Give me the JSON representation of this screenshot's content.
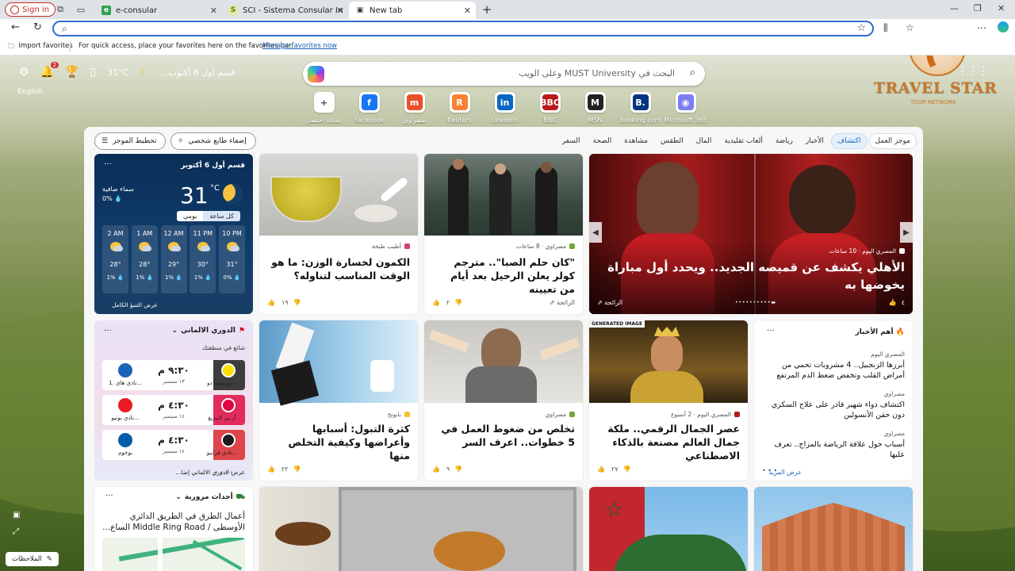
{
  "browser": {
    "signin_label": "Sign in",
    "tabs": [
      {
        "title": "e-consular",
        "icon": "e"
      },
      {
        "title": "SCI - Sistema Consular Integrado",
        "icon": "S"
      },
      {
        "title": "New tab",
        "icon": "▣"
      }
    ],
    "favorites_bar": {
      "import_label": "Import favorites",
      "hint": "For quick access, place your favorites here on the favorites bar.",
      "manage_link": "Manage favorites now"
    }
  },
  "newtab": {
    "topbar": {
      "weather_text": "قسم أول 6 أكتوب...",
      "temperature": "31°C",
      "notification_count": "2",
      "language": "English"
    },
    "search": {
      "placeholder": "البحث في MUST University وعلى الويب"
    },
    "quick_links": [
      {
        "label": "إضافة اختصار",
        "icon": "+",
        "color": "#ffffff",
        "fg": "#444"
      },
      {
        "label": "Facebook",
        "icon": "f",
        "color": "#1877f2",
        "fg": "#fff"
      },
      {
        "label": "مصراوي",
        "icon": "m",
        "color": "#e94e2b",
        "fg": "#fff"
      },
      {
        "label": "Reuters",
        "icon": "R",
        "color": "#fb8033",
        "fg": "#fff"
      },
      {
        "label": "LinkedIn",
        "icon": "in",
        "color": "#0a66c2",
        "fg": "#fff"
      },
      {
        "label": "BBC",
        "icon": "BBC",
        "color": "#bb1919",
        "fg": "#fff"
      },
      {
        "label": "MSN",
        "icon": "M",
        "color": "#222222",
        "fg": "#fff"
      },
      {
        "label": "Booking.com",
        "icon": "B.",
        "color": "#003580",
        "fg": "#fff"
      },
      {
        "label": "Microsoft 365",
        "icon": "◉",
        "color": "#7a7ef0",
        "fg": "#fff"
      }
    ],
    "watermark": {
      "title": "TRAVEL STAR",
      "subtitle": "TOUR NETWORK"
    },
    "notes_label": "الملاحظات"
  },
  "feed": {
    "nav": [
      {
        "label": "موجز العمل"
      },
      {
        "label": "اكتشاف"
      },
      {
        "label": "الأخبار"
      },
      {
        "label": "رياضة"
      },
      {
        "label": "ألعاب تقليدية"
      },
      {
        "label": "المال"
      },
      {
        "label": "الطقس"
      },
      {
        "label": "مشاهدة"
      },
      {
        "label": "الصحة"
      },
      {
        "label": "السفر"
      }
    ],
    "layout_label": "تخطيط الموجز",
    "personalize_label": "إضفاء طابع شخصي",
    "weather": {
      "location_date": "قسم أول 6 أكتوبر",
      "temp": "31",
      "unit": "°C",
      "condition": "سماء صافية",
      "precip": "0% 💧",
      "toggle_hourly": "كل ساعة",
      "toggle_daily": "يومي",
      "hours": [
        {
          "time": "10 PM",
          "temp": "31°",
          "precip": "0% 💧"
        },
        {
          "time": "11 PM",
          "temp": "30°",
          "precip": "1% 💧"
        },
        {
          "time": "12 AM",
          "temp": "29°",
          "precip": "1% 💧"
        },
        {
          "time": "1 AM",
          "temp": "28°",
          "precip": "1% 💧"
        },
        {
          "time": "2 AM",
          "temp": "28°",
          "precip": "1% 💧"
        }
      ],
      "full_forecast": "عرض التنبؤ الكامل"
    },
    "league": {
      "title": "الدوري الالماني",
      "trending": "شائع في منطقتك",
      "matches": [
        {
          "home": "بوروسيا دو...",
          "away": "1. نادي هاي...",
          "time": "٩:٣٠ م",
          "date": "١٣ سبتمبر",
          "home_color": "#fde100",
          "away_color": "#1c63b7",
          "band": "#1b1b1b"
        },
        {
          "home": "آر بي لايبزيغ",
          "away": "نادي يونيو...",
          "time": "٤:٣٠ م",
          "date": "١٤ سبتمبر",
          "home_color": "#dd0741",
          "away_color": "#eb1923",
          "band": "#dd0741"
        },
        {
          "home": "نادي فرايبو...",
          "away": "بوخوم",
          "time": "٤:٣٠ م",
          "date": "١٤ سبتمبر",
          "home_color": "#1b1b1b",
          "away_color": "#005ca9",
          "band": "#d8262c"
        }
      ],
      "footer": "عرض الدوري الالماني إضا..."
    },
    "cards": [
      {
        "source": "أطيب طبخة",
        "headline": "الكمون لخسارة الوزن: ما هو الوقت المناسب لتناوله؟",
        "likes": "١٩",
        "trending": ""
      },
      {
        "source": "مصراوي · 8 ساعات",
        "headline": "\"كان حلم الصبا\".. مترجم كولر يعلن الرحيل بعد أيام من تعيينه",
        "likes": "٢",
        "trending": "الرائجة"
      },
      {
        "source": "المصري اليوم · 10 ساعات",
        "headline": "الأهلي يكشف عن قميصه الجديد.. ويحدد أول مباراة يخوضها به",
        "likes": "٤",
        "trending": "الرائجة"
      },
      {
        "source": "بابونج",
        "headline": "كثرة التبول: أسبابها وأعراضها وكيفية التخلص منها",
        "likes": "٢٢",
        "trending": ""
      },
      {
        "source": "مصراوي",
        "headline": "تخلص من ضغوط العمل في 5 خطوات.. اعرف السر",
        "likes": "٩",
        "trending": ""
      },
      {
        "source": "المصري اليوم · 2 أسبوع",
        "headline": "عصر الجمال الرقمي.. ملكة جمال العالم مصنعة بالذكاء الاصطناعي",
        "likes": "٢٧",
        "trending": "",
        "tag": "GENERATED IMAGE"
      }
    ],
    "top_stories": {
      "title": "أهم الأخبار",
      "items": [
        {
          "source": "المصري اليوم",
          "headline": "أبرزها الزنجبيل.. 4 مشروبات تحمي من أمراض القلب وتخفض ضغط الدم المرتفع"
        },
        {
          "source": "مصراوي",
          "headline": "اكتشاف دواء شهير قادر على علاج السكري دون حقن الأنسولين"
        },
        {
          "source": "مصراوي",
          "headline": "أسباب حول علاقة الرياضة بالمزاج.. تعرف عليها"
        }
      ],
      "more": "عرض المزيد"
    },
    "traffic": {
      "title": "أحداث مرورية",
      "headline": "أعمال الطرق في الطريق الدائري الأوسطى / Middle Ring Road الساع..."
    }
  },
  "colors": {
    "accent": "#0f6cbd",
    "signin_red": "#c42b1c",
    "weather_bg": "#0a2e57"
  }
}
